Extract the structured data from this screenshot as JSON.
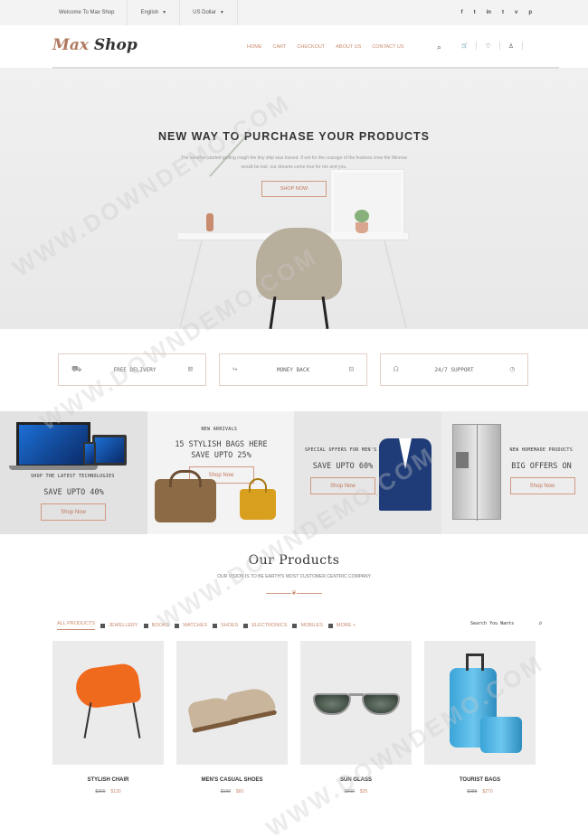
{
  "topbar": {
    "welcome": "Welcome To Max Shop",
    "language": "English",
    "currency": "US Dollar",
    "social": [
      "f",
      "t",
      "in",
      "t",
      "v",
      "p"
    ]
  },
  "header": {
    "logo_max": "Max",
    "logo_shop": "Shop",
    "nav": [
      "HOME",
      "CART",
      "CHECKOUT",
      "ABOUT US",
      "CONTACT US"
    ],
    "search_icon": "⌕",
    "cart_icon": "🛒",
    "heart_icon": "♡",
    "user_icon": "♙"
  },
  "hero": {
    "title": "NEW WAY TO PURCHASE YOUR PRODUCTS",
    "subtitle": "The weather started getting rough the tiny ship was tossed. If not for the courage of the fearless crew the Minnow would be lost. our dreams come true for me and you.",
    "button": "SHOP NOW"
  },
  "features": [
    {
      "label": "FREE DELIVERY"
    },
    {
      "label": "MONEY BACK"
    },
    {
      "label": "24/7 SUPPORT"
    }
  ],
  "promos": [
    {
      "small": "SHOP THE LATEST TECHNOLOGIES",
      "big": "SAVE UPTO 40%",
      "button": "Shop Now"
    },
    {
      "small": "NEW ARRIVALS",
      "big": "15 STYLISH BAGS HERE SAVE UPTO 25%",
      "button": "Shop Now"
    },
    {
      "small": "SPECIAL OFFERS FOR MEN'S",
      "big": "SAVE UPTO 60%",
      "button": "Shop Now"
    },
    {
      "small": "NEW HOMEMADE PRODUCTS",
      "big": "BIG OFFERS ON",
      "button": "Shop Now"
    }
  ],
  "products_section": {
    "title": "Our Products",
    "subtitle": "OUR VISION IS TO BE EARTH'S MOST CUSTOMER CENTRIC COMPANY",
    "filters": [
      "ALL PRODUCTS",
      "JEWELLERY",
      "BOOKS",
      "WATCHES",
      "SHOES",
      "ELECTRONICS",
      "MOBILES",
      "MORE"
    ],
    "more_caret": "+",
    "search_placeholder": "Search You Wants"
  },
  "products": [
    {
      "name": "STYLISH CHAIR",
      "old_price": "$300",
      "price": "$130"
    },
    {
      "name": "MEN'S CASUAL SHOES",
      "old_price": "$190",
      "price": "$60"
    },
    {
      "name": "SUN GLASS",
      "old_price": "$500",
      "price": "$35"
    },
    {
      "name": "TOURIST BAGS",
      "old_price": "$385",
      "price": "$270"
    }
  ],
  "watermark": "WWW.DOWNDEMO.COM"
}
